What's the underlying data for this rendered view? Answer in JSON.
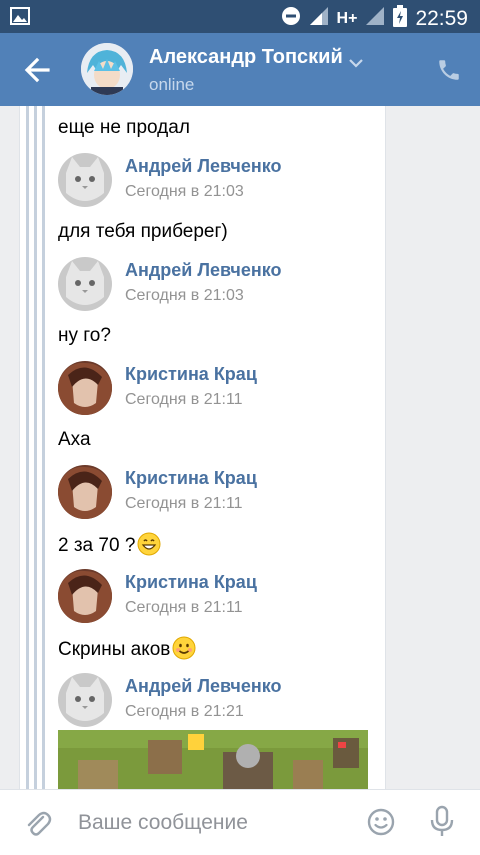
{
  "status_bar": {
    "time": "22:59",
    "network": "H+",
    "icons": [
      "image-icon",
      "do-not-disturb-icon",
      "signal-icon",
      "signal-icon",
      "battery-icon"
    ]
  },
  "header": {
    "contact_name": "Александр Топский",
    "status": "online",
    "back_icon": "arrow-left-icon",
    "call_icon": "phone-icon",
    "dropdown_icon": "chevron-down-icon"
  },
  "messages": [
    {
      "type": "text",
      "text": "еще не продал"
    },
    {
      "type": "author",
      "name": "Андрей Левченко",
      "time": "Сегодня в 21:03",
      "avatar": "cat"
    },
    {
      "type": "text",
      "text": "для тебя приберег)"
    },
    {
      "type": "author",
      "name": "Андрей Левченко",
      "time": "Сегодня в 21:03",
      "avatar": "cat"
    },
    {
      "type": "text",
      "text": "ну го?"
    },
    {
      "type": "author",
      "name": "Кристина Крац",
      "time": "Сегодня в 21:11",
      "avatar": "girl"
    },
    {
      "type": "text",
      "text": "Аха"
    },
    {
      "type": "author",
      "name": "Кристина Крац",
      "time": "Сегодня в 21:11",
      "avatar": "girl"
    },
    {
      "type": "text",
      "text": "2 за 70 ?",
      "emoji": "grinning-emoji"
    },
    {
      "type": "author",
      "name": "Кристина Крац",
      "time": "Сегодня в 21:11",
      "avatar": "girl"
    },
    {
      "type": "text",
      "text": "Скрины аков",
      "emoji": "smiling-emoji"
    },
    {
      "type": "author",
      "name": "Андрей Левченко",
      "time": "Сегодня в 21:21",
      "avatar": "cat"
    },
    {
      "type": "photo",
      "description_icon": "game-screenshot"
    }
  ],
  "composer": {
    "placeholder": "Ваше сообщение",
    "attach_icon": "paperclip-icon",
    "emoji_icon": "smile-icon",
    "mic_icon": "microphone-icon"
  },
  "colors": {
    "status_bar": "#2f4f73",
    "header": "#5181b8",
    "author_name": "#4a72a1",
    "timestamp": "#939393",
    "background": "#edeef0"
  }
}
